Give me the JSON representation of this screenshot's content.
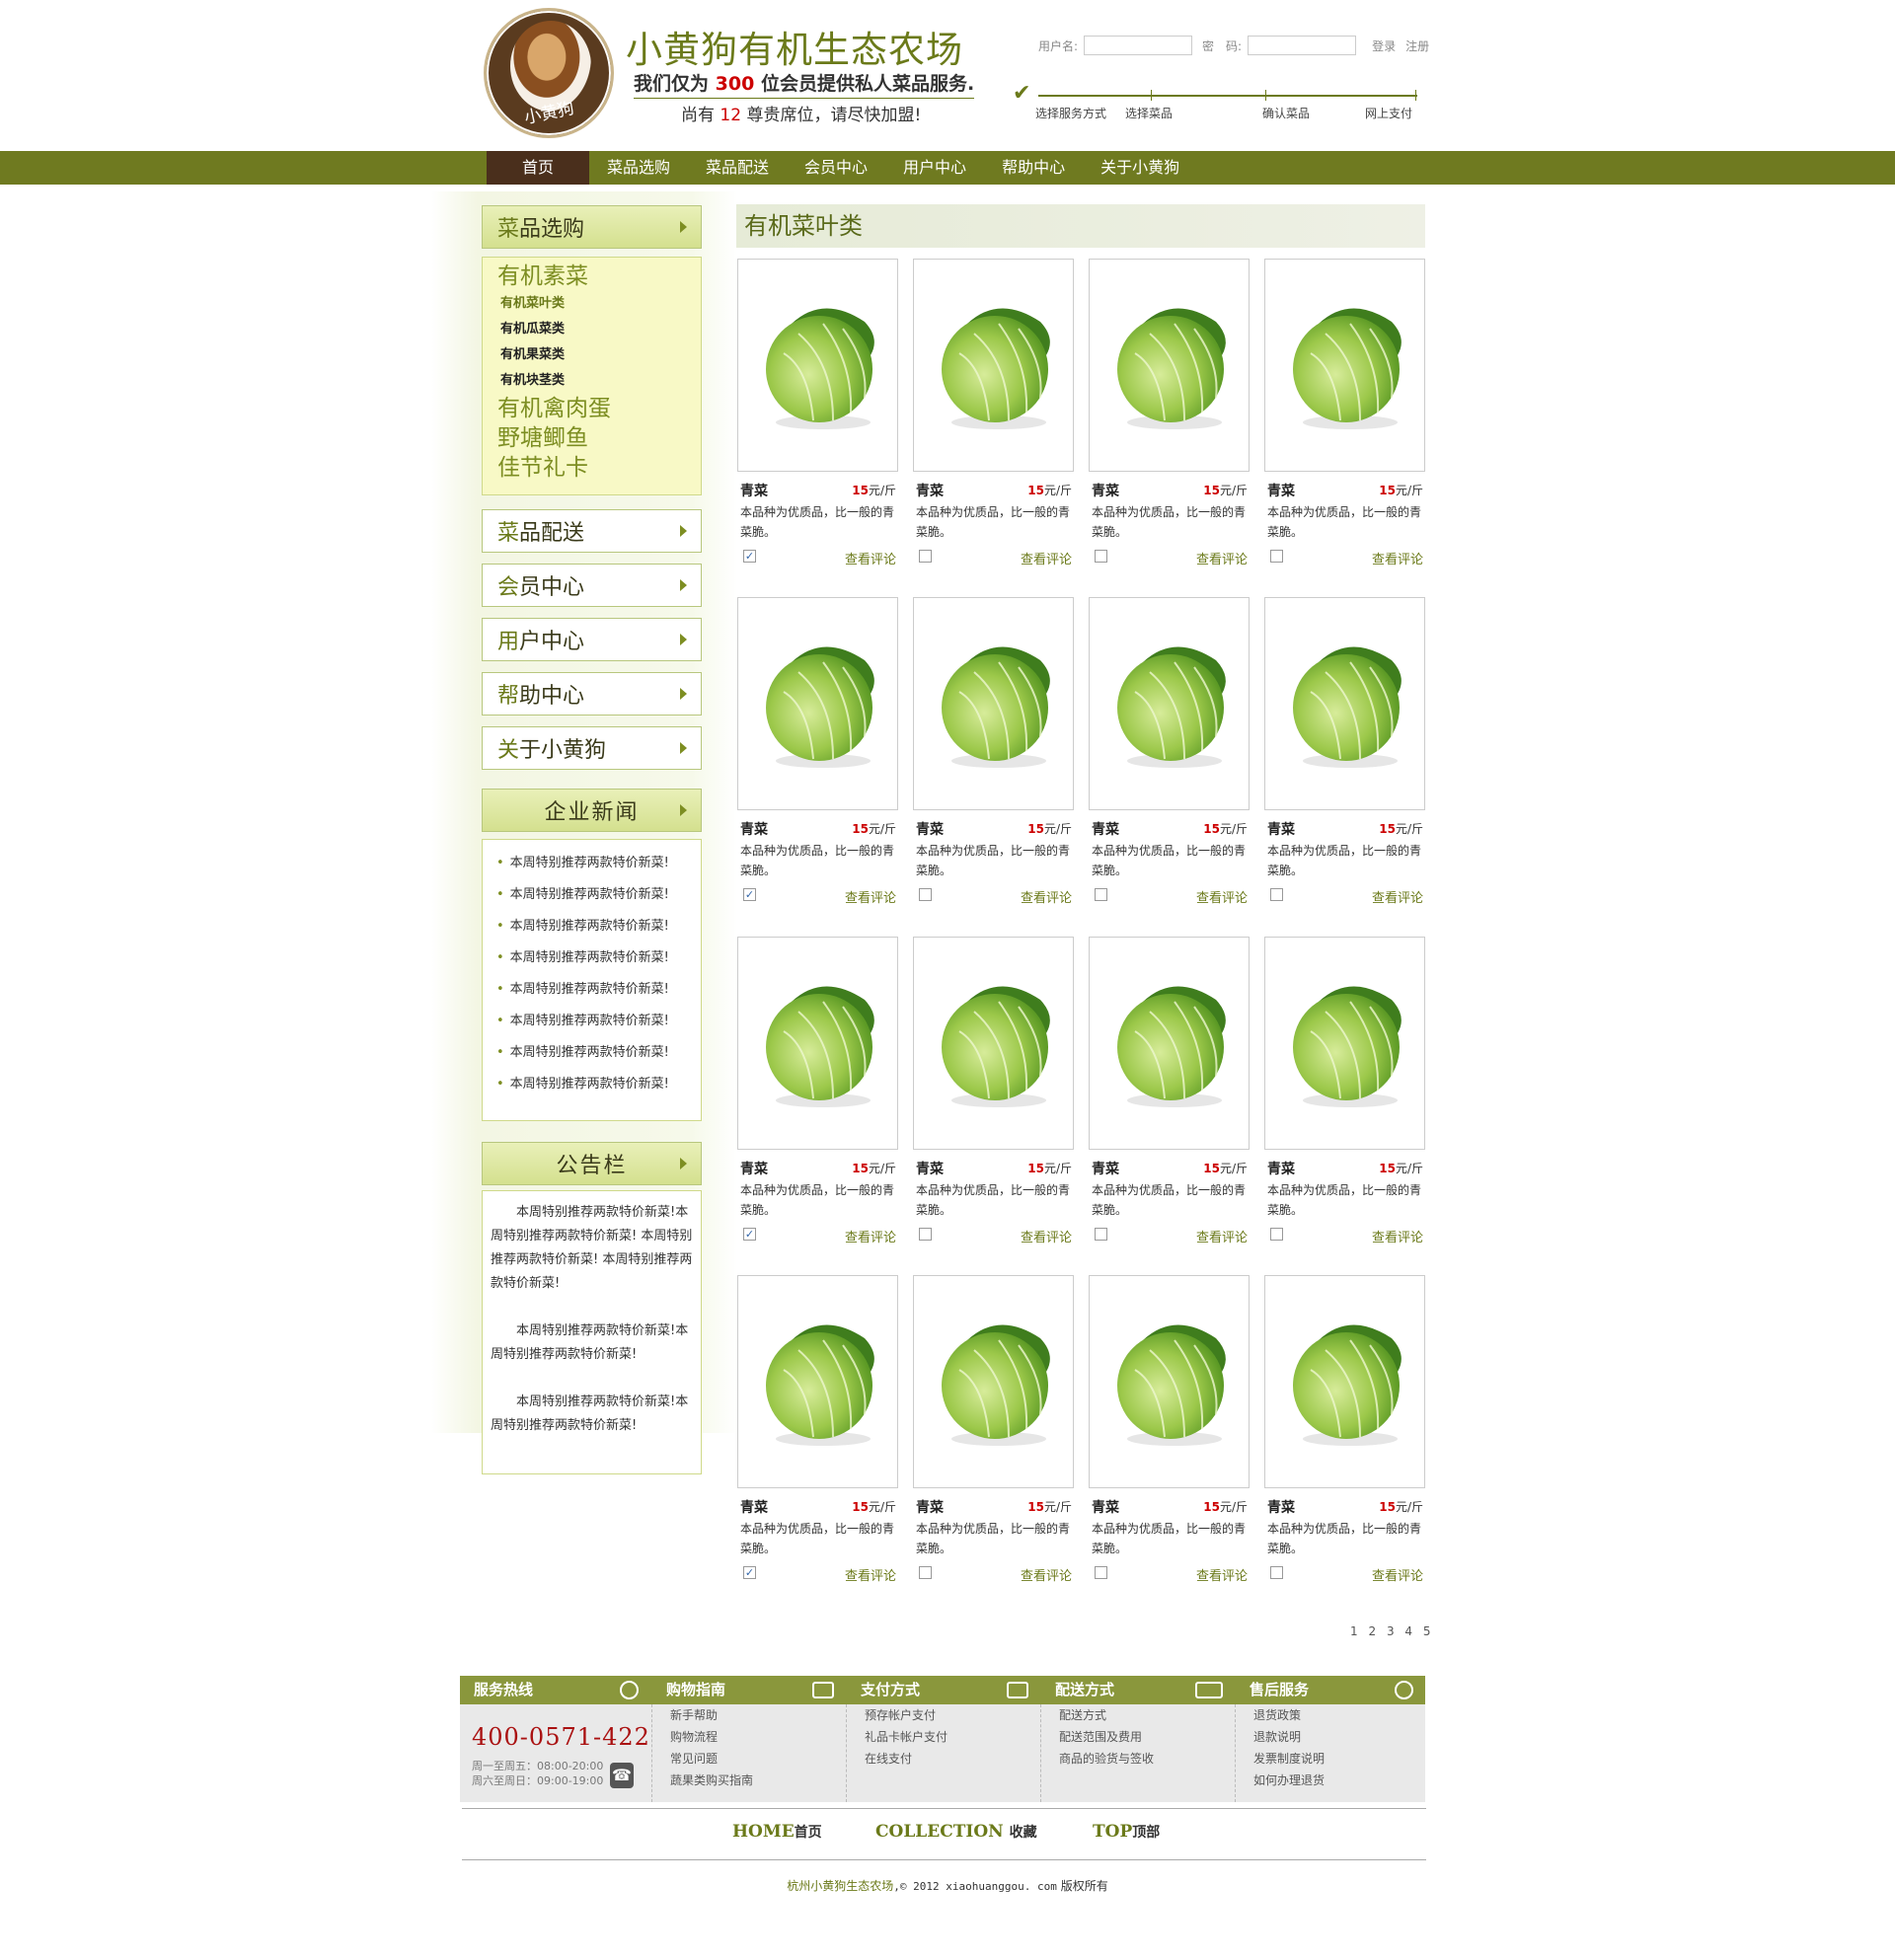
{
  "header": {
    "title": "小黄狗有机生态农场",
    "badge_text": "小黄狗",
    "sub_pre": "我们仅为",
    "sub_num": "300",
    "sub_post": "位会员提供私人菜品服务.",
    "seat_pre": "尚有",
    "seat_num": "12",
    "seat_post": "尊贵席位，请尽快加盟!",
    "login": {
      "username_label": "用户名:",
      "password_label": "密　码:",
      "login_link": "登录",
      "register_link": "注册"
    },
    "steps": [
      "选择服务方式",
      "选择菜品",
      "确认菜品",
      "网上支付"
    ]
  },
  "nav": [
    "首页",
    "菜品选购",
    "菜品配送",
    "会员中心",
    "用户中心",
    "帮助中心",
    "关于小黄狗"
  ],
  "sidebar": {
    "shop_head": {
      "first": "菜",
      "rest": "品选购"
    },
    "categories": {
      "veg_major": "有机素菜",
      "veg_minor": [
        "有机菜叶类",
        "有机瓜菜类",
        "有机果菜类",
        "有机块茎类"
      ],
      "others": [
        "有机禽肉蛋",
        "野塘鲫鱼",
        "佳节礼卡"
      ]
    },
    "menu": [
      {
        "first": "菜",
        "rest": "品配送"
      },
      {
        "first": "会",
        "rest": "员中心"
      },
      {
        "first": "用",
        "rest": "户中心"
      },
      {
        "first": "帮",
        "rest": "助中心"
      },
      {
        "first": "关",
        "rest": "于小黄狗"
      }
    ],
    "news_title": "企业新闻",
    "news": [
      "本周特别推荐两款特价新菜!",
      "本周特别推荐两款特价新菜!",
      "本周特别推荐两款特价新菜!",
      "本周特别推荐两款特价新菜!",
      "本周特别推荐两款特价新菜!",
      "本周特别推荐两款特价新菜!",
      "本周特别推荐两款特价新菜!",
      "本周特别推荐两款特价新菜!"
    ],
    "notice_title": "公告栏",
    "notice": [
      "本周特别推荐两款特价新菜!本周特别推荐两款特价新菜! 本周特别推荐两款特价新菜! 本周特别推荐两款特价新菜!",
      "本周特别推荐两款特价新菜!本周特别推荐两款特价新菜!",
      "本周特别推荐两款特价新菜!本周特别推荐两款特价新菜!"
    ]
  },
  "main": {
    "title": "有机菜叶类",
    "product": {
      "name": "青菜",
      "price_num": "15",
      "price_unit": "元/斤",
      "desc": "本品种为优质品，比一般的青菜脆。",
      "review": "查看评论"
    },
    "checked_columns": [
      true,
      false,
      false,
      false
    ],
    "rows": 4,
    "cols": 4,
    "pager": [
      "1",
      "2",
      "3",
      "4",
      "5"
    ]
  },
  "footer": {
    "hotline_title": "服务热线",
    "hotline": "400-0571-422",
    "hours1": "周一至周五：08:00-20:00",
    "hours2": "周六至周日：09:00-19:00",
    "guide_title": "购物指南",
    "guide": [
      "新手帮助",
      "购物流程",
      "常见问题",
      "蔬果类购买指南"
    ],
    "pay_title": "支付方式",
    "pay": [
      "预存帐户支付",
      "礼品卡帐户支付",
      "在线支付"
    ],
    "ship_title": "配送方式",
    "ship": [
      "配送方式",
      "配送范围及费用",
      "商品的验货与签收"
    ],
    "after_title": "售后服务",
    "after": [
      "退货政策",
      "退款说明",
      "发票制度说明",
      "如何办理退货"
    ],
    "links": [
      {
        "en": "HOME",
        "cn": "首页"
      },
      {
        "en": "COLLECTION",
        "cn": "收藏"
      },
      {
        "en": "TOP",
        "cn": "顶部"
      }
    ],
    "copy_cn": "杭州小黄狗生态农场",
    "copy_mid": ",© 2012 xiaohuanggou. com",
    "copy_end": "版权所有"
  }
}
